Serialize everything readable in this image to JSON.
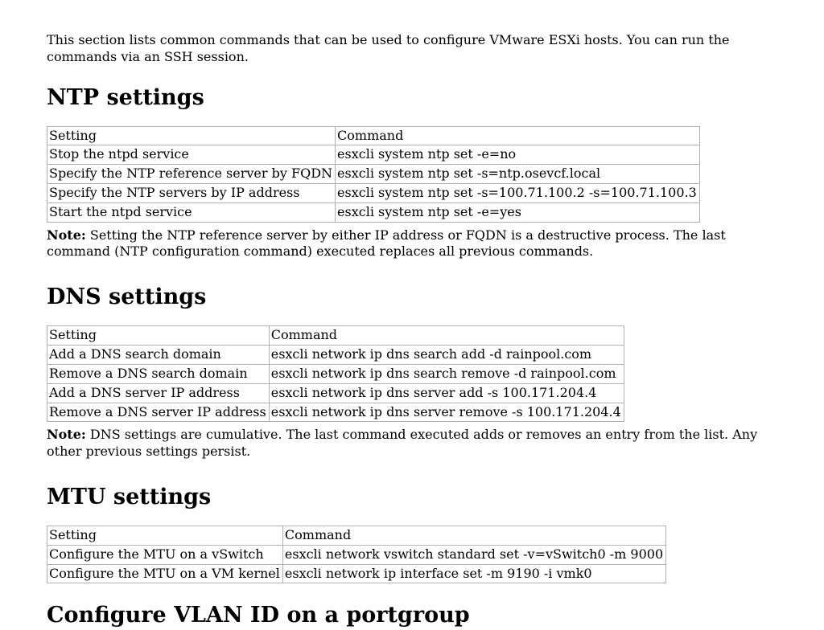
{
  "intro": "This section lists common commands that can be used to configure VMware ESXi hosts. You can run the commands via an SSH session.",
  "sections": {
    "ntp": {
      "heading": "NTP settings",
      "header": {
        "col1": "Setting",
        "col2": "Command"
      },
      "rows": [
        {
          "setting": "Stop the ntpd service",
          "command": "esxcli system ntp set -e=no"
        },
        {
          "setting": "Specify the NTP reference server by FQDN",
          "command": "esxcli system ntp set -s=ntp.osevcf.local"
        },
        {
          "setting": "Specify the NTP servers by IP address",
          "command": "esxcli system ntp set -s=100.71.100.2 -s=100.71.100.3"
        },
        {
          "setting": "Start the ntpd service",
          "command": "esxcli system ntp set -e=yes"
        }
      ],
      "note_label": "Note:",
      "note_text": " Setting the NTP reference server by either IP address or FQDN is a destructive process. The last command (NTP configuration command) executed replaces all previous commands."
    },
    "dns": {
      "heading": "DNS settings",
      "header": {
        "col1": "Setting",
        "col2": "Command"
      },
      "rows": [
        {
          "setting": "Add a DNS search domain",
          "command": "esxcli network ip dns search add -d rainpool.com"
        },
        {
          "setting": "Remove a DNS search domain",
          "command": "esxcli network ip dns search remove -d rainpool.com"
        },
        {
          "setting": "Add a DNS server IP address",
          "command": "esxcli network ip dns server add -s 100.171.204.4"
        },
        {
          "setting": "Remove a DNS server IP address",
          "command": "esxcli network ip dns server remove -s 100.171.204.4"
        }
      ],
      "note_label": "Note:",
      "note_text": " DNS settings are cumulative. The last command executed adds or removes an entry from the list. Any other previous settings persist."
    },
    "mtu": {
      "heading": "MTU settings",
      "header": {
        "col1": "Setting",
        "col2": "Command"
      },
      "rows": [
        {
          "setting": "Configure the MTU on a vSwitch",
          "command": "esxcli network vswitch standard set -v=vSwitch0 -m 9000"
        },
        {
          "setting": "Configure the MTU on a VM kernel",
          "command": "esxcli network ip interface set -m 9190 -i vmk0"
        }
      ]
    },
    "vlan": {
      "heading": "Configure VLAN ID on a portgroup"
    }
  }
}
